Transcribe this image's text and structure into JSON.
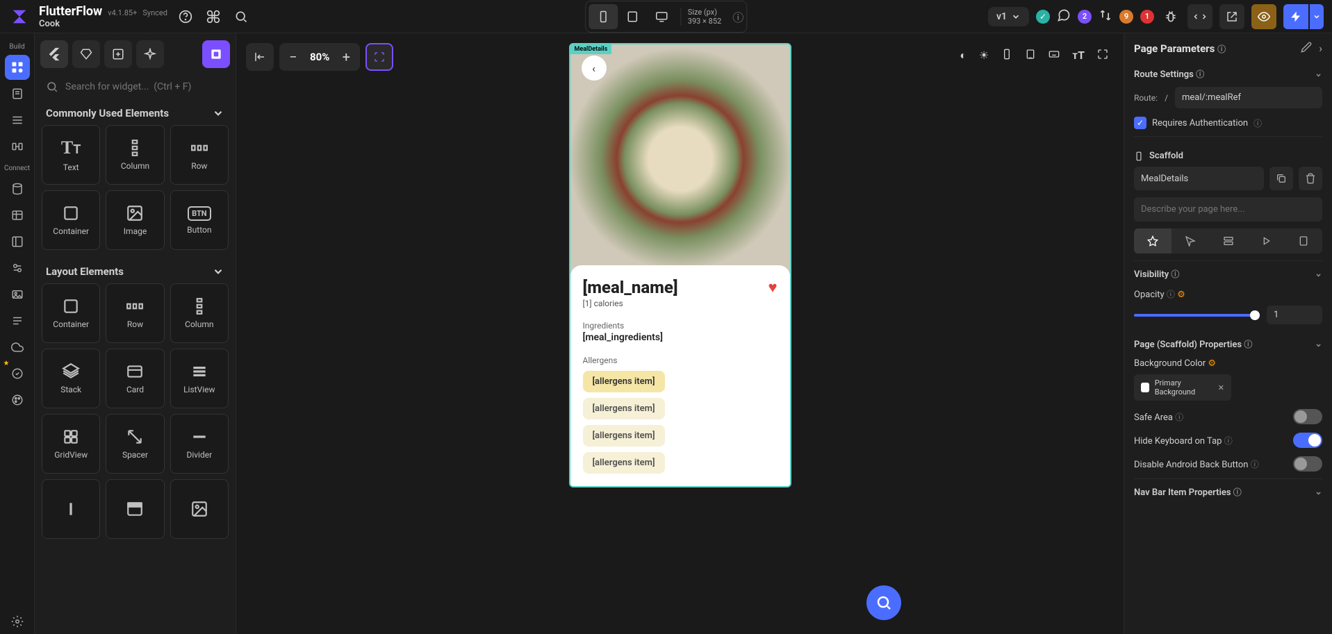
{
  "app": {
    "title": "FlutterFlow",
    "version": "v4.1.85+",
    "sync": "Synced",
    "project": "Cook"
  },
  "top": {
    "version_pill": "v1",
    "badge_purple": "2",
    "badge_orange": "9",
    "badge_red": "1"
  },
  "device": {
    "size_label": "Size (px)",
    "size_value": "393 × 852"
  },
  "leftRail": {
    "build": "Build",
    "connect": "Connect"
  },
  "search": {
    "placeholder": "Search for widget...  (Ctrl + F)"
  },
  "sections": {
    "common": "Commonly Used Elements",
    "layout": "Layout Elements"
  },
  "widgets_common": [
    {
      "label": "Text"
    },
    {
      "label": "Column"
    },
    {
      "label": "Row"
    },
    {
      "label": "Container"
    },
    {
      "label": "Image"
    },
    {
      "label": "Button"
    }
  ],
  "widgets_layout": [
    {
      "label": "Container"
    },
    {
      "label": "Row"
    },
    {
      "label": "Column"
    },
    {
      "label": "Stack"
    },
    {
      "label": "Card"
    },
    {
      "label": "ListView"
    },
    {
      "label": "GridView"
    },
    {
      "label": "Spacer"
    },
    {
      "label": "Divider"
    }
  ],
  "zoom": "80%",
  "preview": {
    "tag": "MealDetails",
    "title": "[meal_name]",
    "subtitle": "[1] calories",
    "ingredients_label": "Ingredients",
    "ingredients_value": "[meal_ingredients]",
    "allergens_label": "Allergens",
    "allergen_chip": "[allergens item]"
  },
  "right": {
    "page_params": "Page Parameters",
    "route_settings": "Route Settings",
    "route_lbl": "Route:",
    "route_slash": "/",
    "route_value": "meal/:mealRef",
    "req_auth": "Requires Authentication",
    "scaffold": "Scaffold",
    "scaffold_name": "MealDetails",
    "desc_placeholder": "Describe your page here...",
    "visibility": "Visibility",
    "opacity": "Opacity",
    "opacity_val": "1",
    "scaffold_props": "Page (Scaffold) Properties",
    "bg_color": "Background Color",
    "bg_value": "Primary Background",
    "safe_area": "Safe Area",
    "hide_kb": "Hide Keyboard on Tap",
    "disable_back": "Disable Android Back Button",
    "nav_bar": "Nav Bar Item Properties"
  }
}
